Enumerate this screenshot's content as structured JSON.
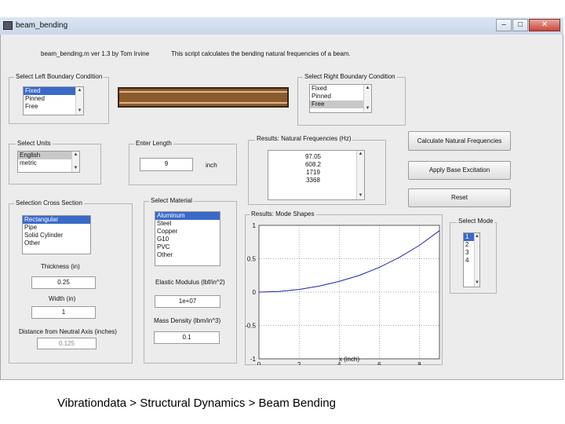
{
  "window": {
    "title": "beam_bending",
    "min": "–",
    "max": "□",
    "close": "✕"
  },
  "header": {
    "version": "beam_bending.m  ver 1.3  by Tom Irvine",
    "description": "This script calculates the bending natural frequencies of a beam."
  },
  "left_bc": {
    "title": "Select Left Boundary Condition",
    "items": [
      "Fixed",
      "Pinned",
      "Free"
    ],
    "selected": 0
  },
  "right_bc": {
    "title": "Select Right Boundary Condition",
    "items": [
      "Fixed",
      "Pinned",
      "Free"
    ],
    "selected": 2
  },
  "units": {
    "title": "Select Units",
    "items": [
      "English",
      "metric"
    ],
    "selected": 0
  },
  "length": {
    "title": "Enter Length",
    "value": "9",
    "unit": "inch"
  },
  "results_freq": {
    "title": "Results:  Natural Frequencies (Hz)",
    "items": [
      "97.05",
      "608.2",
      "1719",
      "3368"
    ]
  },
  "buttons": {
    "calc": "Calculate Natural Frequencies",
    "base": "Apply Base Excitation",
    "reset": "Reset"
  },
  "cross_section": {
    "title": "Selection Cross Section",
    "items": [
      "Rectangular",
      "Pipe",
      "Solid Cylinder",
      "Other"
    ],
    "selected": 0
  },
  "material": {
    "title": "Select Material",
    "items": [
      "Aluminum",
      "Steel",
      "Copper",
      "G10",
      "PVC",
      "Other"
    ],
    "selected": 0
  },
  "thickness": {
    "label": "Thickness (in)",
    "value": "0.25"
  },
  "width": {
    "label": "Width (in)",
    "value": "1"
  },
  "neutral_axis": {
    "label": "Distance from Neutral Axis (inches)",
    "value": "0.125"
  },
  "elastic": {
    "label": "Elastic Modulus (lbf/in^2)",
    "value": "1e+07"
  },
  "density": {
    "label": "Mass Density (lbm/in^3)",
    "value": "0.1"
  },
  "mode_shapes": {
    "title": "Results:  Mode Shapes"
  },
  "select_mode": {
    "title": "Select Mode",
    "items": [
      "1",
      "2",
      "3",
      "4"
    ],
    "selected": 0
  },
  "chart_data": {
    "type": "line",
    "title": "",
    "xlabel": "x (inch)",
    "ylabel": "",
    "xlim": [
      0,
      9
    ],
    "ylim": [
      -1,
      1
    ],
    "xticks": [
      "0",
      "2",
      "4",
      "6",
      "8"
    ],
    "yticks": [
      "1",
      "0.5",
      "0",
      "-0.5",
      "-1"
    ],
    "grid": true,
    "series": [
      {
        "color": "#1f1fb4",
        "x": [
          0,
          1,
          2,
          3,
          4,
          5,
          6,
          7,
          8,
          9
        ],
        "y": [
          0,
          0.009,
          0.04,
          0.09,
          0.16,
          0.25,
          0.37,
          0.52,
          0.7,
          0.92
        ]
      }
    ]
  },
  "caption": "Vibrationdata > Structural Dynamics > Beam Bending"
}
